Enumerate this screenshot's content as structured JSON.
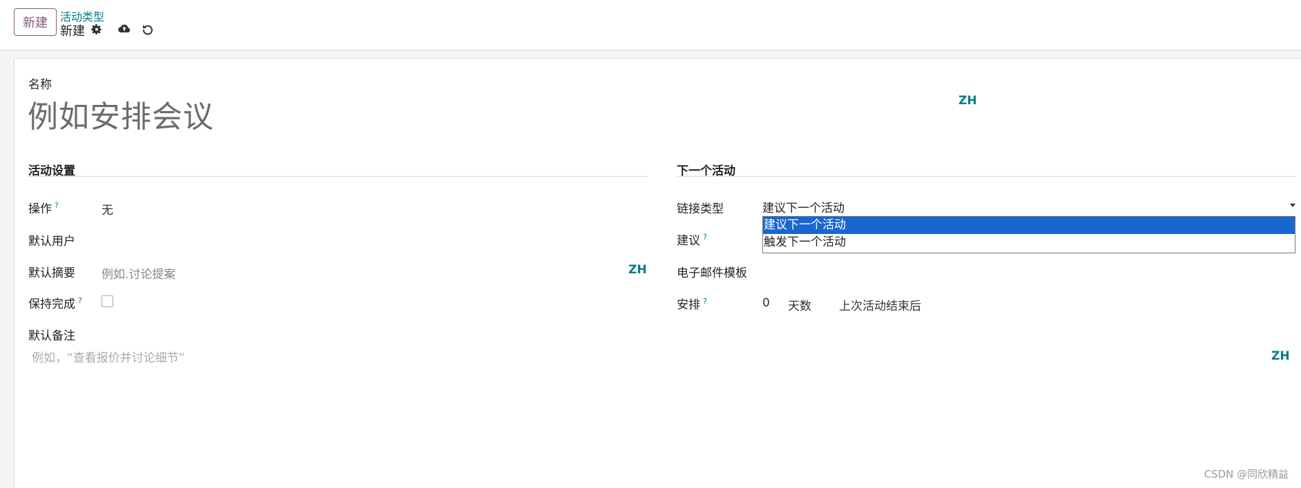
{
  "topbar": {
    "new_button": "新建",
    "breadcrumb_parent": "活动类型",
    "breadcrumb_current": "新建",
    "icons": [
      "gear-icon",
      "cloud-upload-icon",
      "undo-icon"
    ]
  },
  "form": {
    "name_label": "名称",
    "name_placeholder": "例如安排会议",
    "lang_tag": "ZH",
    "activity_settings": {
      "title": "活动设置",
      "action_label": "操作",
      "action_value": "无",
      "default_user_label": "默认用户",
      "default_summary_label": "默认摘要",
      "default_summary_placeholder": "例如.讨论提案",
      "keep_done_label": "保持完成",
      "default_note_label": "默认备注",
      "default_note_placeholder": "例如，“查看报价并讨论细节”"
    },
    "next_activity": {
      "title": "下一个活动",
      "chaining_type_label": "链接类型",
      "chaining_type_value": "建议下一个活动",
      "chaining_options": [
        "建议下一个活动",
        "触发下一个活动"
      ],
      "suggest_label": "建议",
      "email_template_label": "电子邮件模板",
      "schedule_label": "安排",
      "schedule_value": "0",
      "schedule_unit": "天数",
      "schedule_from": "上次活动结束后"
    },
    "help_mark": "?"
  },
  "watermark": "CSDN @同欣精益",
  "colors": {
    "accent": "#875a7b",
    "link": "#017e84",
    "selected": "#1a66d1"
  }
}
